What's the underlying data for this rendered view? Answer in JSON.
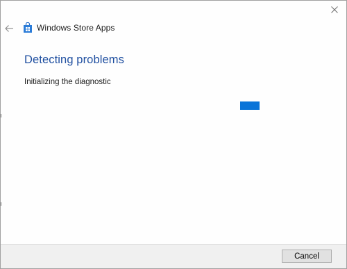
{
  "window": {
    "app_title": "Windows Store Apps",
    "close_icon": "close-icon",
    "back_icon": "back-arrow-icon",
    "app_icon": "store-bag-icon"
  },
  "main": {
    "title": "Detecting problems",
    "status": "Initializing the diagnostic"
  },
  "footer": {
    "cancel_label": "Cancel"
  },
  "colors": {
    "title": "#1f4fa0",
    "progress": "#0a74d8",
    "footer_bg": "#f0f0f0"
  }
}
